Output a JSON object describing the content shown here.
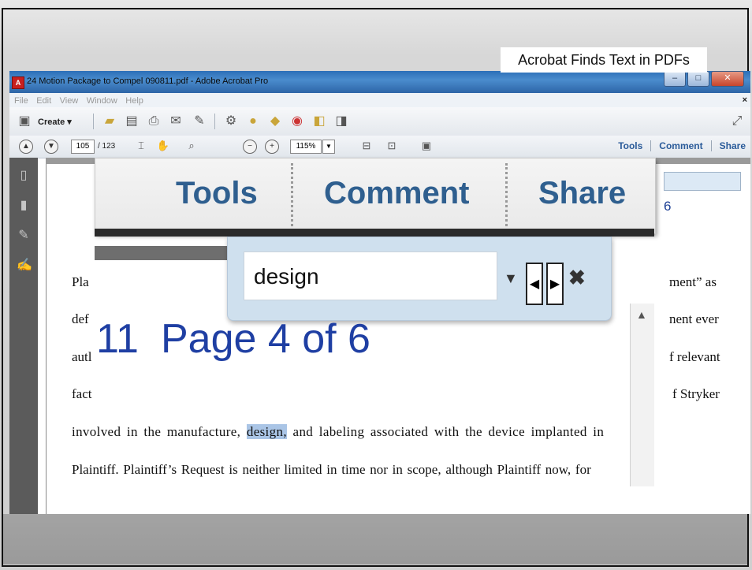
{
  "window": {
    "title": "24 Motion Package to Compel  090811.pdf - Adobe Acrobat Pro",
    "menu": [
      "File",
      "Edit",
      "View",
      "Window",
      "Help"
    ]
  },
  "toolbar": {
    "create_label": "Create ▾",
    "current_page": "105",
    "total_pages": "/ 123",
    "zoom": "115%",
    "right_tabs": [
      "Tools",
      "Comment",
      "Share"
    ]
  },
  "callout": "Acrobat Finds Text in PDFs",
  "zoomed_tabs": [
    "Tools",
    "Comment",
    "Share"
  ],
  "find": {
    "query": "design"
  },
  "page_indicator": {
    "number": "11",
    "label": "Page 4 of 6",
    "partial": "6"
  },
  "document": {
    "line1_left": "Pla",
    "line1_right": "ment” as",
    "line2_left": "def",
    "line2_right": "nent ever",
    "line3_left": "autl",
    "line3_right": "f relevant",
    "line4_left": "fact",
    "line4_right": "f Stryker",
    "line5_before": "involved in the manufacture,",
    "line5_highlight": "design,",
    "line5_after": "and labeling associated with the device implanted in",
    "line6": "Plaintiff.  Plaintiff’s Request is neither limited in time nor in scope, although Plaintiff now, for"
  }
}
